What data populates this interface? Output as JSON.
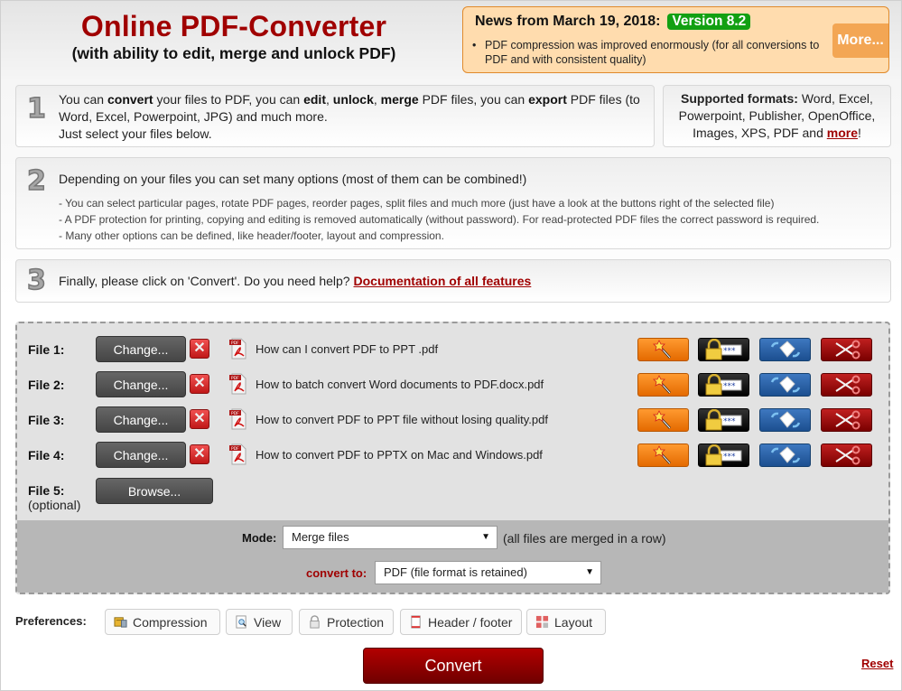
{
  "header": {
    "title": "Online PDF-Converter",
    "subtitle": "(with ability to edit, merge and unlock PDF)"
  },
  "news": {
    "heading": "News from March 19, 2018:",
    "version_badge": "Version 8.2",
    "items": [
      "PDF compression was improved enormously (for all conversions to PDF and with consistent quality)"
    ],
    "more_button": "More...",
    "colors": {
      "background": "#ffdcae",
      "border": "#e08a2c",
      "badge": "#12a012",
      "more": "#f3a654"
    }
  },
  "steps": [
    {
      "number": "1",
      "parts": [
        {
          "t": "You can ",
          "b": false
        },
        {
          "t": "convert",
          "b": true
        },
        {
          "t": " your files to PDF, you can ",
          "b": false
        },
        {
          "t": "edit",
          "b": true
        },
        {
          "t": ", ",
          "b": false
        },
        {
          "t": "unlock",
          "b": true
        },
        {
          "t": ", ",
          "b": false
        },
        {
          "t": "merge",
          "b": true
        },
        {
          "t": " PDF files, you can ",
          "b": false
        },
        {
          "t": "export",
          "b": true
        },
        {
          "t": " PDF files (to Word, Excel, Powerpoint, JPG) and much more.",
          "b": false
        }
      ],
      "line2": "Just select your files below."
    },
    {
      "number": "2",
      "text": "Depending on your files you can set many options (most of them can be combined!)",
      "details": [
        "- You can select particular pages, rotate PDF pages, reorder pages, split files and much more (just have a look at the buttons right of the selected file)",
        "- A PDF protection for printing, copying and editing is removed automatically (without password). For read-protected PDF files the correct password is required.",
        "- Many other options can be defined, like header/footer, layout and compression."
      ]
    },
    {
      "number": "3",
      "text": "Finally, please click on 'Convert'. Do you need help?",
      "link": "Documentation of all features"
    }
  ],
  "formats": {
    "label": "Supported formats:",
    "text": "Word, Excel, Powerpoint, Publisher, OpenOffice, Images, XPS, PDF and",
    "link": "more",
    "suffix": "!"
  },
  "files": [
    {
      "label": "File 1:",
      "button": "Change...",
      "name": "How can I convert PDF to PPT .pdf"
    },
    {
      "label": "File 2:",
      "button": "Change...",
      "name": "How to batch convert Word documents to PDF.docx.pdf"
    },
    {
      "label": "File 3:",
      "button": "Change...",
      "name": "How to convert PDF to PPT file without losing quality.pdf"
    },
    {
      "label": "File 4:",
      "button": "Change...",
      "name": "How to convert PDF to PPTX on Mac and Windows.pdf"
    }
  ],
  "file_actions": [
    "magic-wand-edit",
    "lock-password",
    "rotate-page",
    "scissors-split"
  ],
  "file5": {
    "label": "File 5:",
    "optional": "(optional)",
    "button": "Browse..."
  },
  "mode": {
    "label": "Mode:",
    "selected": "Merge files",
    "hint": "(all files are merged in a row)"
  },
  "convert_to": {
    "label": "convert to:",
    "selected": "PDF (file format is retained)"
  },
  "preferences": {
    "label": "Preferences:",
    "buttons": [
      "Compression",
      "View",
      "Protection",
      "Header / footer",
      "Layout"
    ]
  },
  "actions": {
    "convert": "Convert",
    "reset": "Reset"
  },
  "colors": {
    "brand_red": "#a00000"
  }
}
